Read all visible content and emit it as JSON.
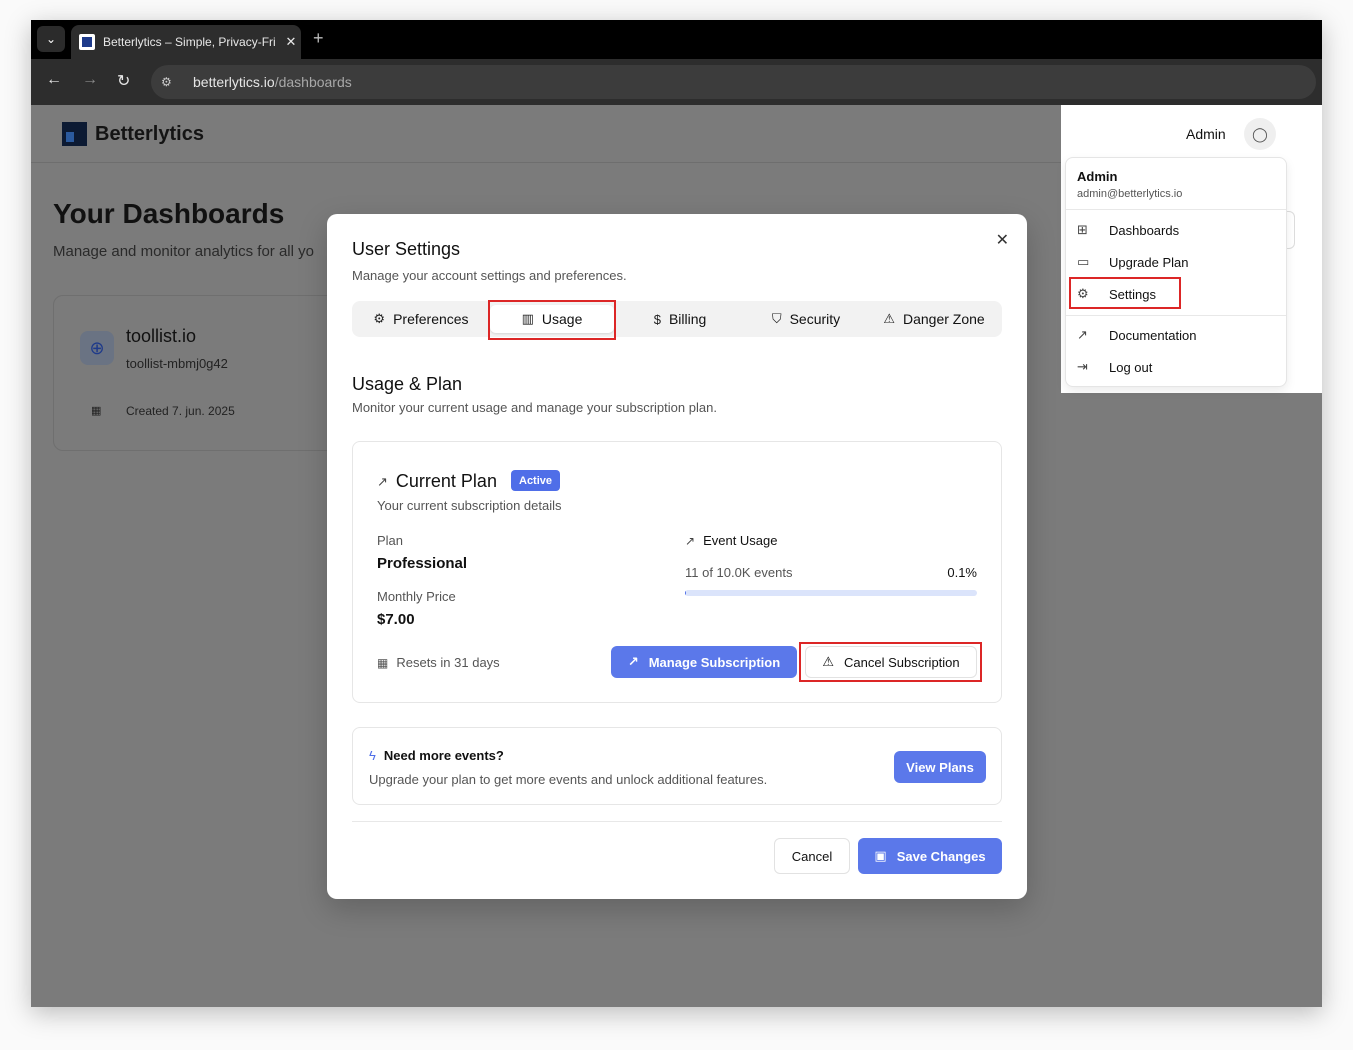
{
  "browser": {
    "tab_title": "Betterlytics – Simple, Privacy-Fri",
    "tab_list_glyph": "⌄",
    "tab_close_glyph": "✕",
    "new_tab_glyph": "+",
    "url_host": "betterlytics.io",
    "url_path": "/dashboards",
    "back_glyph": "←",
    "forward_glyph": "→",
    "reload_glyph": "↻",
    "site_settings_glyph": "⚙"
  },
  "header": {
    "brand": "Betterlytics",
    "user_label": "Admin"
  },
  "page": {
    "title": "Your Dashboards",
    "subtitle": "Manage and monitor analytics for all yo",
    "card": {
      "name": "toollist.io",
      "slug": "toollist-mbmj0g42",
      "created": "Created 7. jun. 2025"
    }
  },
  "user_menu": {
    "name": "Admin",
    "email": "admin@betterlytics.io",
    "items": [
      {
        "label": "Dashboards",
        "icon": "grid-icon"
      },
      {
        "label": "Upgrade Plan",
        "icon": "credit-card-icon"
      },
      {
        "label": "Settings",
        "icon": "gear-icon"
      },
      {
        "label": "Documentation",
        "icon": "external-link-icon"
      },
      {
        "label": "Log out",
        "icon": "logout-icon"
      }
    ]
  },
  "modal": {
    "title": "User Settings",
    "subtitle": "Manage your account settings and preferences.",
    "tabs": [
      {
        "label": "Preferences",
        "icon": "gear-icon"
      },
      {
        "label": "Usage",
        "icon": "bar-chart-icon"
      },
      {
        "label": "Billing",
        "icon": "dollar-receipt-icon"
      },
      {
        "label": "Security",
        "icon": "shield-icon"
      },
      {
        "label": "Danger Zone",
        "icon": "warning-icon"
      }
    ],
    "active_tab": "Usage",
    "section_title": "Usage & Plan",
    "section_subtitle": "Monitor your current usage and manage your subscription plan.",
    "current_plan": {
      "title": "Current Plan",
      "badge": "Active",
      "description": "Your current subscription details",
      "plan_label": "Plan",
      "plan_value": "Professional",
      "price_label": "Monthly Price",
      "price_value": "$7.00",
      "event_usage_title": "Event Usage",
      "event_count": "11 of 10.0K events",
      "event_percent": "0.1%",
      "event_fraction": 0.001,
      "resets": "Resets in 31 days",
      "manage_button": "Manage Subscription",
      "cancel_button": "Cancel Subscription"
    },
    "upsell": {
      "title": "Need more events?",
      "description": "Upgrade your plan to get more events and unlock additional features.",
      "button": "View Plans"
    },
    "cancel": "Cancel",
    "save": "Save Changes"
  },
  "colors": {
    "accent": "#5b78ea",
    "highlight_box": "#dc2626",
    "overlay": "#7b7b7b"
  }
}
